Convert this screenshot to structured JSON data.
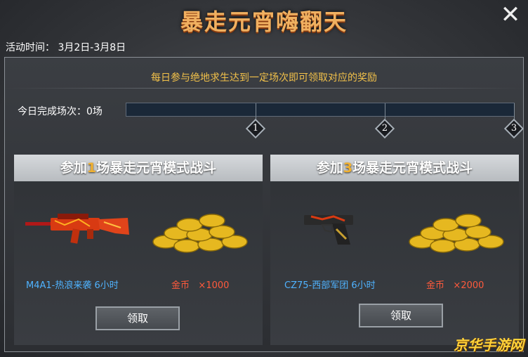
{
  "title": "暴走元宵嗨翻天",
  "event_time": "活动时间： 3月2日-3月8日",
  "tip": "每日参与绝地求生达到一定场次即可领取对应的奖励",
  "progress": {
    "label": "今日完成场次：0场",
    "completed": 0,
    "milestones": [
      "1",
      "2",
      "3"
    ]
  },
  "cards": [
    {
      "head_prefix": "参加",
      "head_num": "1",
      "head_suffix": "场暴走元宵模式战斗",
      "item": "M4A1-热浪来袭 6小时",
      "gold_name": "金币",
      "gold_amount": "×1000",
      "claim": "领取"
    },
    {
      "head_prefix": "参加",
      "head_num": "3",
      "head_suffix": "场暴走元宵模式战斗",
      "item": "CZ75-西部军团 6小时",
      "gold_name": "金币",
      "gold_amount": "×2000",
      "claim": "领取"
    }
  ],
  "watermark": "京华手游网",
  "icons": {
    "close": "close-icon",
    "rifle": "rifle-icon",
    "pistol": "pistol-icon",
    "coins": "gold-coins-icon"
  }
}
